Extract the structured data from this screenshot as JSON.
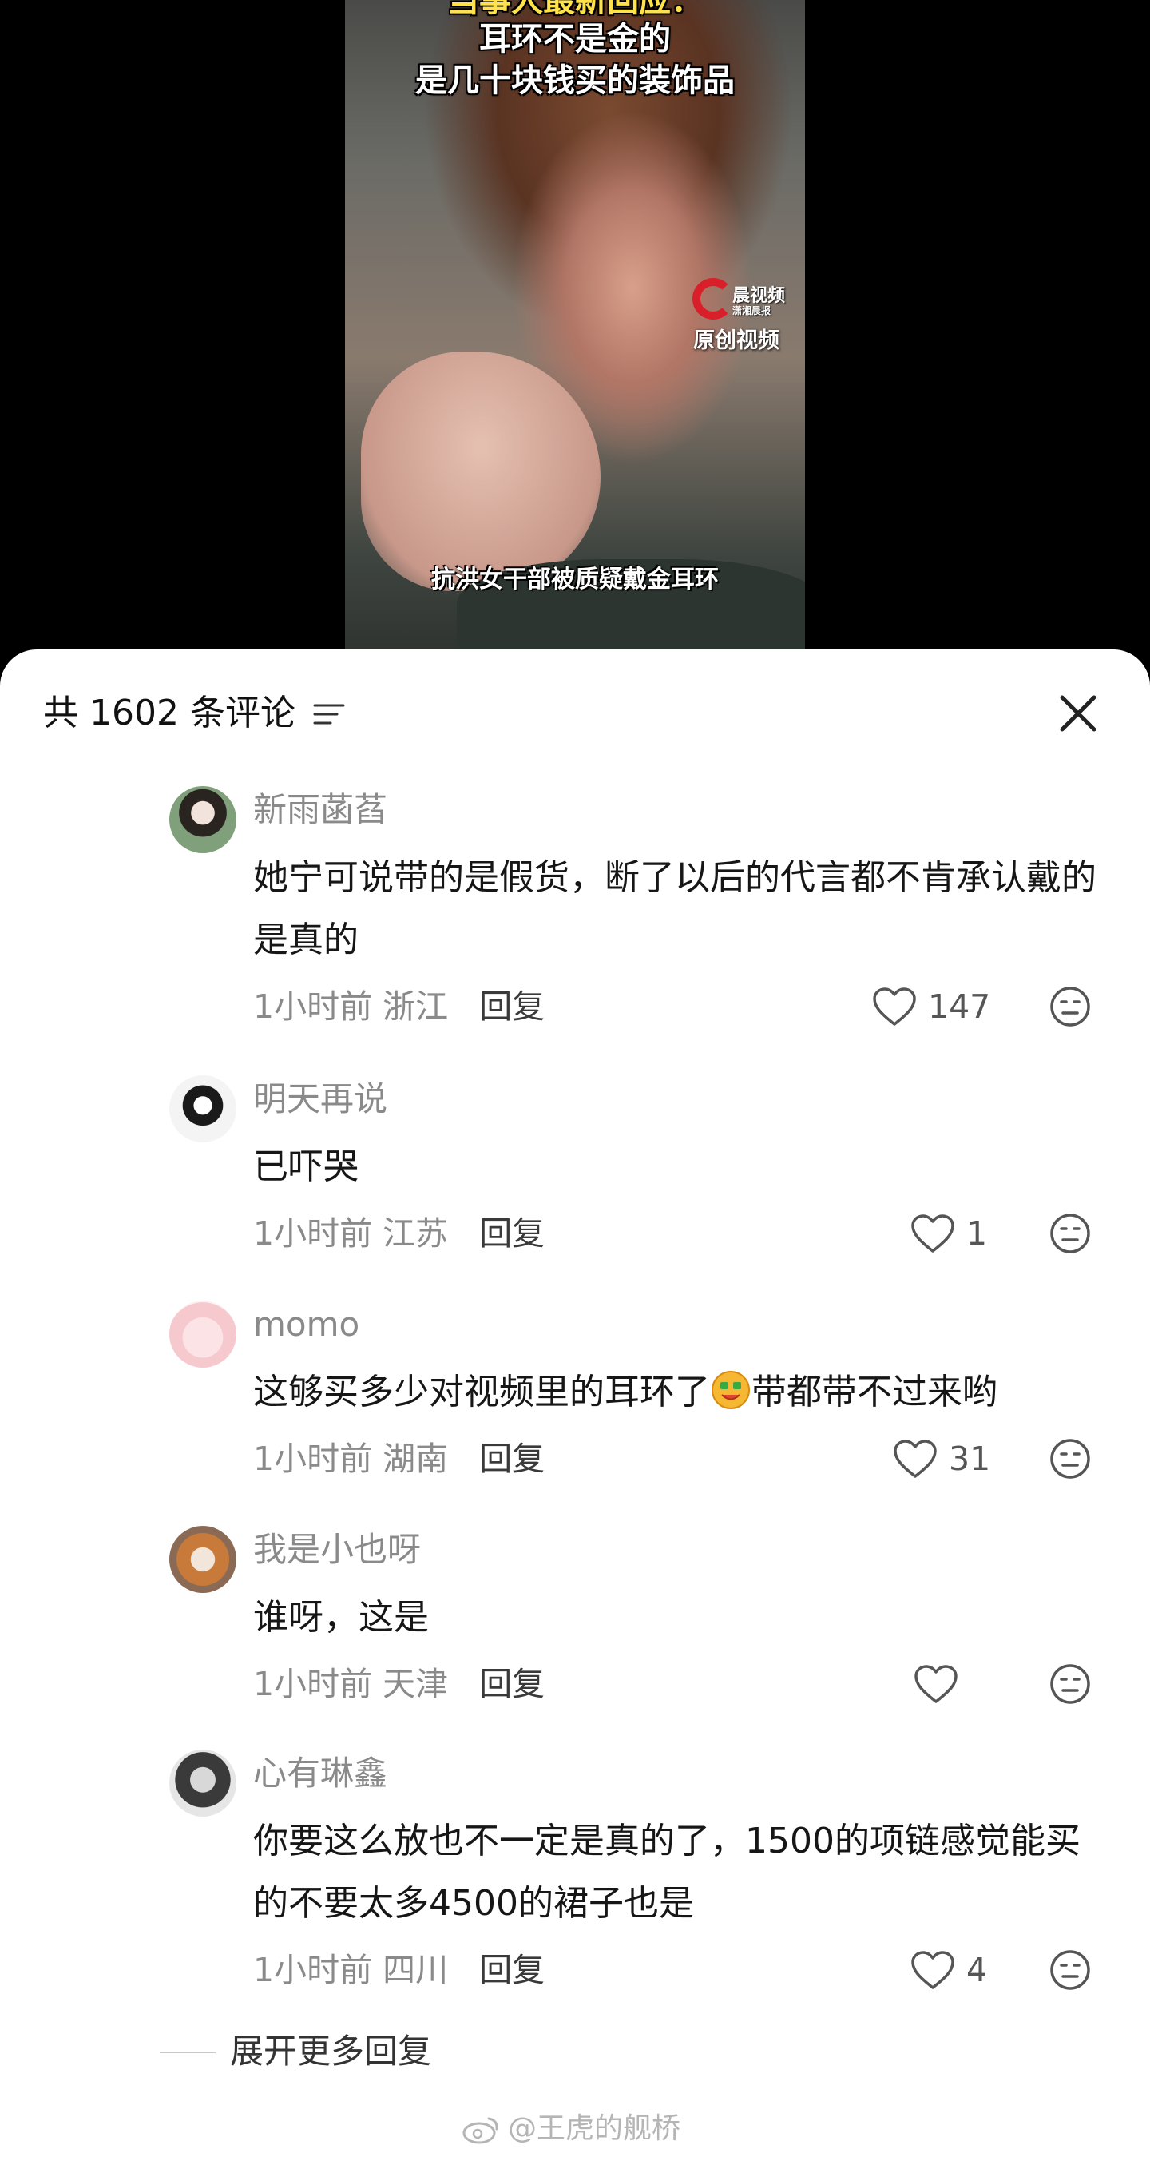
{
  "video": {
    "caption_top": [
      "当事人最新回应：",
      "耳环不是金的",
      "是几十块钱买的装饰品"
    ],
    "logo_name": "晨视频",
    "logo_sub": "潇湘晨报",
    "original_label": "原创视频",
    "caption_bottom": "抗洪女干部被质疑戴金耳环"
  },
  "header": {
    "comment_count_label": "共 1602 条评论",
    "sort_icon": "sort-lines-icon",
    "close_icon": "close-x-icon"
  },
  "comments": [
    {
      "username": "新雨菡萏",
      "text": "她宁可说带的是假货，断了以后的代言都不肯承认戴的是真的",
      "time": "1小时前",
      "location": "浙江",
      "reply_label": "回复",
      "likes": "147"
    },
    {
      "username": "明天再说",
      "text": "已吓哭",
      "time": "1小时前",
      "location": "江苏",
      "reply_label": "回复",
      "likes": "1"
    },
    {
      "username": "momo",
      "text": "这够买多少对视频里的耳环了",
      "text_after_emoji": "带都带不过来哟",
      "emoji": "money-face-emoji",
      "time": "1小时前",
      "location": "湖南",
      "reply_label": "回复",
      "likes": "31"
    },
    {
      "username": "我是小也呀",
      "text": "谁呀，这是",
      "time": "1小时前",
      "location": "天津",
      "reply_label": "回复",
      "likes": ""
    },
    {
      "username": "心有琳鑫",
      "text": "你要这么放也不一定是真的了，1500的项链感觉能买的不要太多4500的裙子也是",
      "time": "1小时前",
      "location": "四川",
      "reply_label": "回复",
      "likes": "4"
    }
  ],
  "expand_more_label": "展开更多回复",
  "watermark": "@王虎的舰桥",
  "colors": {
    "text_primary": "#161616",
    "text_secondary": "#8a8a8a",
    "sheet_bg": "#ffffff",
    "video_bg": "#000000",
    "caption_yellow": "#ffe14a",
    "logo_red": "#d9202a"
  }
}
